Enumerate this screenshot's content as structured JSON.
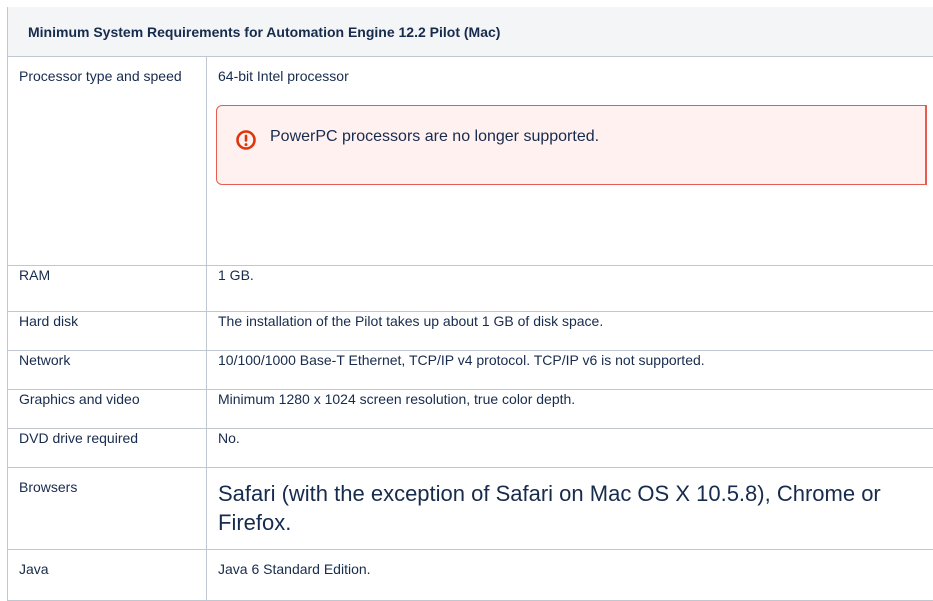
{
  "table": {
    "title": "Minimum System Requirements for Automation Engine 12.2 Pilot (Mac)",
    "rows": [
      {
        "label": "Processor type and speed",
        "value": "64-bit Intel processor"
      },
      {
        "label": "RAM",
        "value": "1 GB."
      },
      {
        "label": "Hard disk",
        "value": "The installation of the Pilot takes up about 1 GB of disk space."
      },
      {
        "label": "Network",
        "value": "10/100/1000 Base-T Ethernet, TCP/IP v4 protocol. TCP/IP v6 is not supported."
      },
      {
        "label": "Graphics and video",
        "value": "Minimum 1280 x 1024 screen resolution, true color depth."
      },
      {
        "label": "DVD drive required",
        "value": "No."
      },
      {
        "label": "Browsers",
        "value": "Safari (with the exception of Safari on Mac OS X 10.5.8), Chrome or Firefox."
      },
      {
        "label": "Java",
        "value": "Java 6 Standard Edition."
      }
    ]
  },
  "note": {
    "icon": "warning-icon",
    "text": "PowerPC processors are no longer supported.",
    "color": "#e65c51",
    "background": "#fff1ef"
  }
}
